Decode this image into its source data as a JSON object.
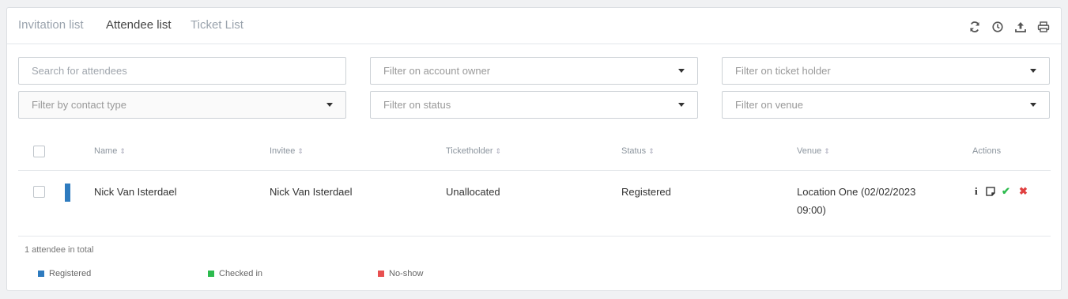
{
  "tabs": [
    {
      "label": "Invitation list",
      "active": false
    },
    {
      "label": "Attendee list",
      "active": true
    },
    {
      "label": "Ticket List",
      "active": false
    }
  ],
  "toolbar": {
    "icons": [
      "refresh-icon",
      "clock-icon",
      "upload-icon",
      "print-icon"
    ]
  },
  "filters": {
    "search_placeholder": "Search for attendees",
    "account_owner": "Filter on account owner",
    "ticket_holder": "Filter on ticket holder",
    "contact_type": "Filter by contact type",
    "status": "Filter on status",
    "venue": "Filter on venue"
  },
  "table": {
    "columns": [
      "Name",
      "Invitee",
      "Ticketholder",
      "Status",
      "Venue",
      "Actions"
    ],
    "rows": [
      {
        "name": "Nick Van Isterdael",
        "invitee": "Nick Van Isterdael",
        "ticketholder": "Unallocated",
        "status": "Registered",
        "venue": "Location One (02/02/2023 09:00)",
        "status_color": "#2e7bbf"
      }
    ]
  },
  "footer": {
    "total": "1 attendee in total"
  },
  "legend": [
    {
      "label": "Registered",
      "color": "#2e7bbf"
    },
    {
      "label": "Checked in",
      "color": "#2dbb4e"
    },
    {
      "label": "No-show",
      "color": "#e85050"
    }
  ],
  "colors": {
    "accent": "#2e7bbf",
    "check": "#2dbb4e",
    "cross": "#e04040"
  }
}
